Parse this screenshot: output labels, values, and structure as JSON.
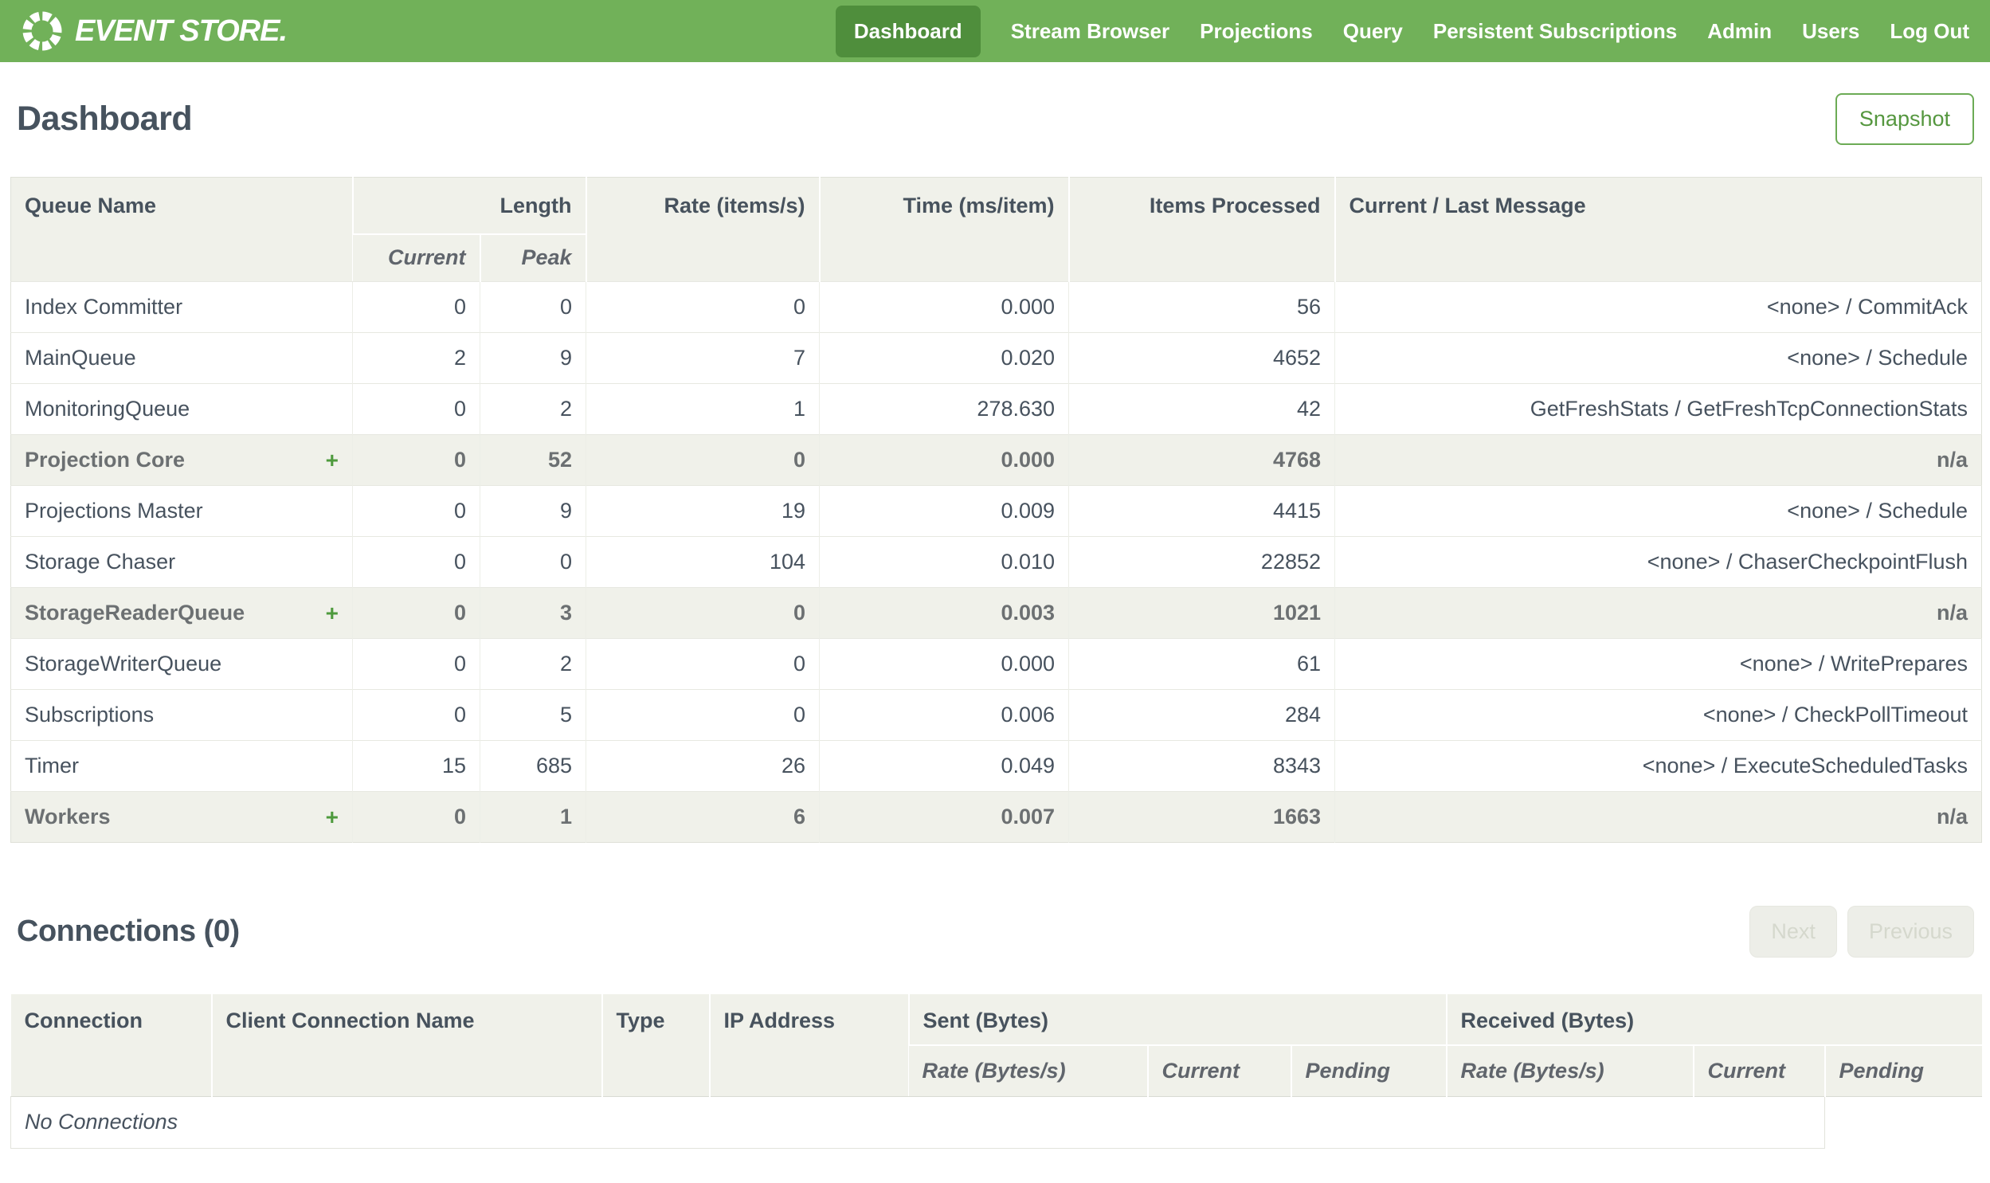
{
  "header": {
    "brand": "EVENT STORE.",
    "logo_icon": "segmented-ring-icon",
    "nav": [
      {
        "label": "Dashboard",
        "active": true
      },
      {
        "label": "Stream Browser",
        "active": false
      },
      {
        "label": "Projections",
        "active": false
      },
      {
        "label": "Query",
        "active": false
      },
      {
        "label": "Persistent Subscriptions",
        "active": false
      },
      {
        "label": "Admin",
        "active": false
      },
      {
        "label": "Users",
        "active": false
      },
      {
        "label": "Log Out",
        "active": false
      }
    ]
  },
  "page": {
    "title": "Dashboard",
    "snapshot_label": "Snapshot"
  },
  "queues_table": {
    "expand_symbol": "+",
    "headers": {
      "queue_name": "Queue Name",
      "length": "Length",
      "current": "Current",
      "peak": "Peak",
      "rate": "Rate (items/s)",
      "time": "Time (ms/item)",
      "items": "Items Processed",
      "message": "Current / Last Message"
    },
    "rows": [
      {
        "name": "Index Committer",
        "group": false,
        "current": "0",
        "peak": "0",
        "rate": "0",
        "time": "0.000",
        "items": "56",
        "message": "<none> / CommitAck"
      },
      {
        "name": "MainQueue",
        "group": false,
        "current": "2",
        "peak": "9",
        "rate": "7",
        "time": "0.020",
        "items": "4652",
        "message": "<none> / Schedule"
      },
      {
        "name": "MonitoringQueue",
        "group": false,
        "current": "0",
        "peak": "2",
        "rate": "1",
        "time": "278.630",
        "items": "42",
        "message": "GetFreshStats / GetFreshTcpConnectionStats"
      },
      {
        "name": "Projection Core",
        "group": true,
        "current": "0",
        "peak": "52",
        "rate": "0",
        "time": "0.000",
        "items": "4768",
        "message": "n/a"
      },
      {
        "name": "Projections Master",
        "group": false,
        "current": "0",
        "peak": "9",
        "rate": "19",
        "time": "0.009",
        "items": "4415",
        "message": "<none> / Schedule"
      },
      {
        "name": "Storage Chaser",
        "group": false,
        "current": "0",
        "peak": "0",
        "rate": "104",
        "time": "0.010",
        "items": "22852",
        "message": "<none> / ChaserCheckpointFlush"
      },
      {
        "name": "StorageReaderQueue",
        "group": true,
        "current": "0",
        "peak": "3",
        "rate": "0",
        "time": "0.003",
        "items": "1021",
        "message": "n/a"
      },
      {
        "name": "StorageWriterQueue",
        "group": false,
        "current": "0",
        "peak": "2",
        "rate": "0",
        "time": "0.000",
        "items": "61",
        "message": "<none> / WritePrepares"
      },
      {
        "name": "Subscriptions",
        "group": false,
        "current": "0",
        "peak": "5",
        "rate": "0",
        "time": "0.006",
        "items": "284",
        "message": "<none> / CheckPollTimeout"
      },
      {
        "name": "Timer",
        "group": false,
        "current": "15",
        "peak": "685",
        "rate": "26",
        "time": "0.049",
        "items": "8343",
        "message": "<none> / ExecuteScheduledTasks"
      },
      {
        "name": "Workers",
        "group": true,
        "current": "0",
        "peak": "1",
        "rate": "6",
        "time": "0.007",
        "items": "1663",
        "message": "n/a"
      }
    ]
  },
  "connections": {
    "title": "Connections (0)",
    "next_label": "Next",
    "previous_label": "Previous",
    "buttons_disabled": true,
    "headers": {
      "connection": "Connection",
      "client_name": "Client Connection Name",
      "type": "Type",
      "ip": "IP Address",
      "sent": "Sent (Bytes)",
      "received": "Received (Bytes)",
      "rate": "Rate (Bytes/s)",
      "current": "Current",
      "pending": "Pending"
    },
    "empty_message": "No Connections"
  },
  "colors": {
    "topbar_green": "#71b159",
    "active_nav_green": "#4f8e3c",
    "accent_green": "#55973f",
    "table_header_bg": "#f0f1ea",
    "heading_text": "#46525e"
  }
}
